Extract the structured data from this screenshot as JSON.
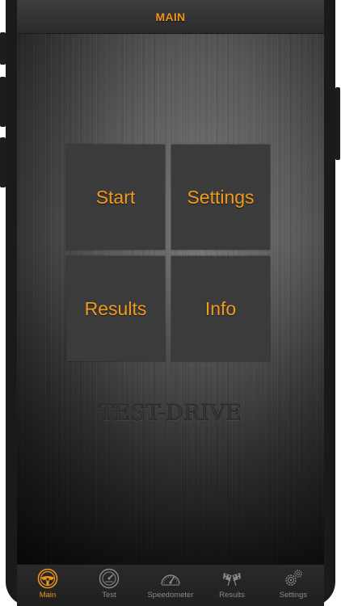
{
  "header": {
    "title": "MAIN"
  },
  "menu": {
    "start_label": "Start",
    "settings_label": "Settings",
    "results_label": "Results",
    "info_label": "Info"
  },
  "brand": {
    "text": "TEST-DRIVE"
  },
  "tabs": [
    {
      "label": "Main",
      "icon": "steering-wheel-icon",
      "active": true
    },
    {
      "label": "Test",
      "icon": "gauge-icon",
      "active": false
    },
    {
      "label": "Speedometer",
      "icon": "speedometer-icon",
      "active": false
    },
    {
      "label": "Results",
      "icon": "checkered-flags-icon",
      "active": false
    },
    {
      "label": "Settings",
      "icon": "gears-icon",
      "active": false
    }
  ],
  "colors": {
    "accent": "#f0961e",
    "tile": "#3b3b3b",
    "inactive": "#8a8a8a"
  }
}
